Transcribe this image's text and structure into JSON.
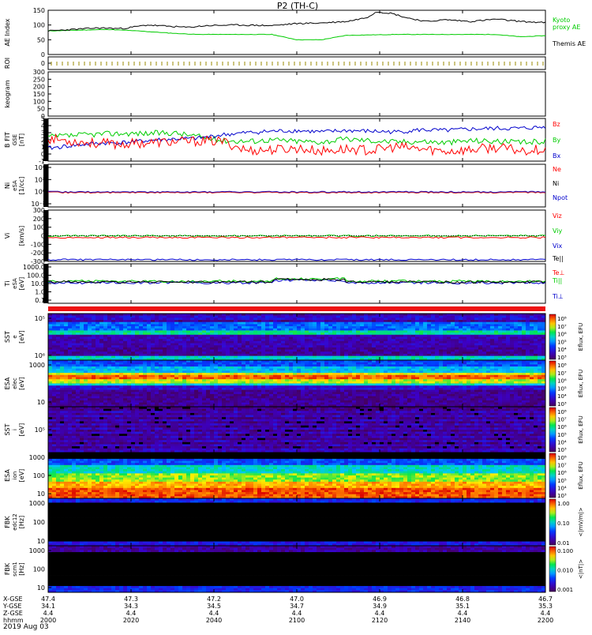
{
  "title": "P2 (TH-C)",
  "date_label": "2019 Aug 03",
  "chart_data": {
    "type": "line",
    "xlabel": "hhmm",
    "x_ticks": [
      "2000",
      "2020",
      "2040",
      "2100",
      "2120",
      "2140",
      "2200"
    ],
    "ephemeris": {
      "row_labels": [
        "X-GSE",
        "Y-GSE",
        "Z-GSE",
        "hhmm"
      ],
      "rows": [
        [
          "47.4",
          "47.3",
          "47.2",
          "47.0",
          "46.9",
          "46.8",
          "46.7"
        ],
        [
          "34.1",
          "34.3",
          "34.5",
          "34.7",
          "34.9",
          "35.1",
          "35.3"
        ],
        [
          "4.4",
          "4.4",
          "4.4",
          "4.4",
          "4.4",
          "4.4",
          "4.4"
        ]
      ]
    },
    "panels": [
      {
        "id": "ae",
        "ylabel": "AE Index",
        "ylim": [
          0,
          150
        ],
        "yticks": [
          "0",
          "50",
          "100",
          "150"
        ],
        "series": [
          {
            "name": "Kyoto proxy AE",
            "color": "#00cc00",
            "x": [
              0,
              0.05,
              0.12,
              0.18,
              0.25,
              0.3,
              0.38,
              0.45,
              0.5,
              0.55,
              0.6,
              0.7,
              0.8,
              0.9,
              0.95,
              1.0
            ],
            "values": [
              80,
              82,
              85,
              80,
              72,
              68,
              68,
              68,
              50,
              50,
              65,
              68,
              68,
              68,
              60,
              64
            ]
          },
          {
            "name": "Themis AE",
            "color": "#000000",
            "x": [
              0,
              0.05,
              0.1,
              0.15,
              0.2,
              0.28,
              0.32,
              0.38,
              0.45,
              0.5,
              0.55,
              0.6,
              0.64,
              0.66,
              0.69,
              0.72,
              0.76,
              0.8,
              0.85,
              0.9,
              0.95,
              1.0
            ],
            "values": [
              80,
              85,
              90,
              88,
              100,
              92,
              98,
              100,
              98,
              105,
              107,
              112,
              125,
              145,
              140,
              125,
              112,
              118,
              112,
              120,
              112,
              108
            ]
          }
        ]
      },
      {
        "id": "roi",
        "ylabel": "ROI",
        "yticks": [
          "0"
        ]
      },
      {
        "id": "keogram",
        "ylabel": "keogram",
        "ylim": [
          0,
          300
        ],
        "yticks": [
          "0",
          "50",
          "100",
          "150",
          "200",
          "250",
          "300"
        ]
      },
      {
        "id": "bfield",
        "ylabel": "B FIT",
        "ylabel2": "GSE",
        "unit": "[nT]",
        "ylim": [
          -1,
          5
        ],
        "yticks": [
          "-1",
          "0",
          "1",
          "2",
          "3",
          "4",
          "5"
        ],
        "series": [
          {
            "name": "Bz",
            "color": "#ff0000",
            "x": [
              0,
              0.05,
              0.1,
              0.15,
              0.2,
              0.25,
              0.3,
              0.35,
              0.4,
              0.45,
              0.5,
              0.55,
              0.6,
              0.65,
              0.7,
              0.75,
              0.8,
              0.85,
              0.9,
              0.95,
              1.0
            ],
            "values": [
              2.2,
              1.8,
              1.5,
              1.4,
              1.6,
              1.7,
              1.8,
              1.8,
              0.5,
              0.6,
              0.8,
              0.4,
              0.7,
              0.5,
              1.0,
              0.7,
              0.4,
              0.6,
              0.9,
              0.5,
              0.7
            ]
          },
          {
            "name": "By",
            "color": "#00cc00",
            "x": [
              0,
              0.05,
              0.1,
              0.15,
              0.2,
              0.25,
              0.3,
              0.35,
              0.4,
              0.45,
              0.5,
              0.55,
              0.6,
              0.65,
              0.7,
              0.75,
              0.8,
              0.85,
              0.9,
              0.95,
              1.0
            ],
            "values": [
              2.4,
              2.6,
              2.8,
              2.9,
              2.9,
              3.0,
              2.5,
              1.9,
              1.8,
              2.0,
              1.8,
              1.7,
              2.1,
              1.9,
              1.7,
              1.8,
              1.6,
              1.9,
              1.8,
              1.6,
              1.8
            ]
          },
          {
            "name": "Bx",
            "color": "#0000cc",
            "x": [
              0,
              0.05,
              0.1,
              0.15,
              0.2,
              0.25,
              0.3,
              0.35,
              0.4,
              0.45,
              0.5,
              0.55,
              0.6,
              0.65,
              0.7,
              0.75,
              0.8,
              0.85,
              0.9,
              0.95,
              1.0
            ],
            "values": [
              0.8,
              1.2,
              1.5,
              1.6,
              1.9,
              2.1,
              2.2,
              2.7,
              3.0,
              3.2,
              3.3,
              3.1,
              3.3,
              3.2,
              3.1,
              3.4,
              3.3,
              3.5,
              3.6,
              3.6,
              3.8
            ]
          }
        ]
      },
      {
        "id": "density",
        "ylabel": "Ni",
        "ylabel2": "eSA",
        "unit": "[1/cc]",
        "yticks": [
          "10⁻²",
          "10⁰",
          "10²",
          "10⁴"
        ],
        "legend": [
          "Ne",
          "Ni",
          "Npot"
        ],
        "legend_colors": [
          "#ff0000",
          "#000000",
          "#0000cc"
        ]
      },
      {
        "id": "velocity",
        "ylabel": "Vi",
        "ylabel2": "",
        "unit": "[km/s]",
        "ylim": [
          -300,
          300
        ],
        "yticks": [
          "-300",
          "-200",
          "-100",
          "0",
          "100",
          "200",
          "300"
        ],
        "legend": [
          "Viz",
          "Viy",
          "Vix"
        ],
        "legend_colors": [
          "#ff0000",
          "#00cc00",
          "#0000cc"
        ]
      },
      {
        "id": "temperature",
        "ylabel": "Ti",
        "ylabel2": "eSA",
        "unit": "[eV]",
        "yticks": [
          "0.1",
          "1.0",
          "10.0",
          "100.0",
          "1000.0"
        ],
        "legend": [
          "Te||",
          "Te⊥",
          "Ti||",
          "Ti⊥"
        ],
        "legend_colors": [
          "#000000",
          "#ff0000",
          "#00cc00",
          "#0000cc"
        ]
      },
      {
        "id": "sst-e",
        "ylabel": "SST",
        "ylabel2": "e",
        "unit": "[eV]",
        "yticks": [
          "10⁵",
          "10⁶"
        ],
        "cbar_label": "Eflux, EFU",
        "cbar_ticks": [
          "10⁸",
          "10⁷",
          "10⁶",
          "10⁵",
          "10⁴",
          "10³"
        ]
      },
      {
        "id": "esa-e",
        "ylabel": "ESA",
        "ylabel2": "elec",
        "unit": "[eV]",
        "yticks": [
          "1000",
          "10"
        ],
        "cbar_label": "Eflux, EFU",
        "cbar_ticks": [
          "10⁸",
          "10⁷",
          "10⁶",
          "10⁵",
          "10⁴",
          "10³"
        ]
      },
      {
        "id": "sst-i",
        "ylabel": "SST",
        "ylabel2": "i",
        "unit": "[eV]",
        "yticks": [
          "10⁵"
        ],
        "cbar_label": "Eflux, EFU",
        "cbar_ticks": [
          "10⁸",
          "10⁷",
          "10⁶",
          "10⁵",
          "10⁴",
          "10³"
        ]
      },
      {
        "id": "esa-i",
        "ylabel": "ESA",
        "ylabel2": "ion",
        "unit": "[eV]",
        "yticks": [
          "1000",
          "100",
          "10"
        ],
        "cbar_label": "Eflux, EFU",
        "cbar_ticks": [
          "10⁸",
          "10⁷",
          "10⁶",
          "10⁵",
          "10⁴",
          "10³"
        ]
      },
      {
        "id": "fbk-e",
        "ylabel": "FBK",
        "ylabel2": "edc12",
        "unit": "[Hz]",
        "yticks": [
          "1000",
          "100",
          "10"
        ],
        "cbar_label": "<|mV/m|>",
        "cbar_ticks": [
          "1.00",
          "0.10",
          "0.01"
        ]
      },
      {
        "id": "fbk-b",
        "ylabel": "FBK",
        "ylabel2": "scm1",
        "unit": "[Hz]",
        "yticks": [
          "1000",
          "100",
          "10"
        ],
        "cbar_label": "<|nT|>",
        "cbar_ticks": [
          "0.100",
          "0.010",
          "0.001"
        ]
      }
    ]
  }
}
